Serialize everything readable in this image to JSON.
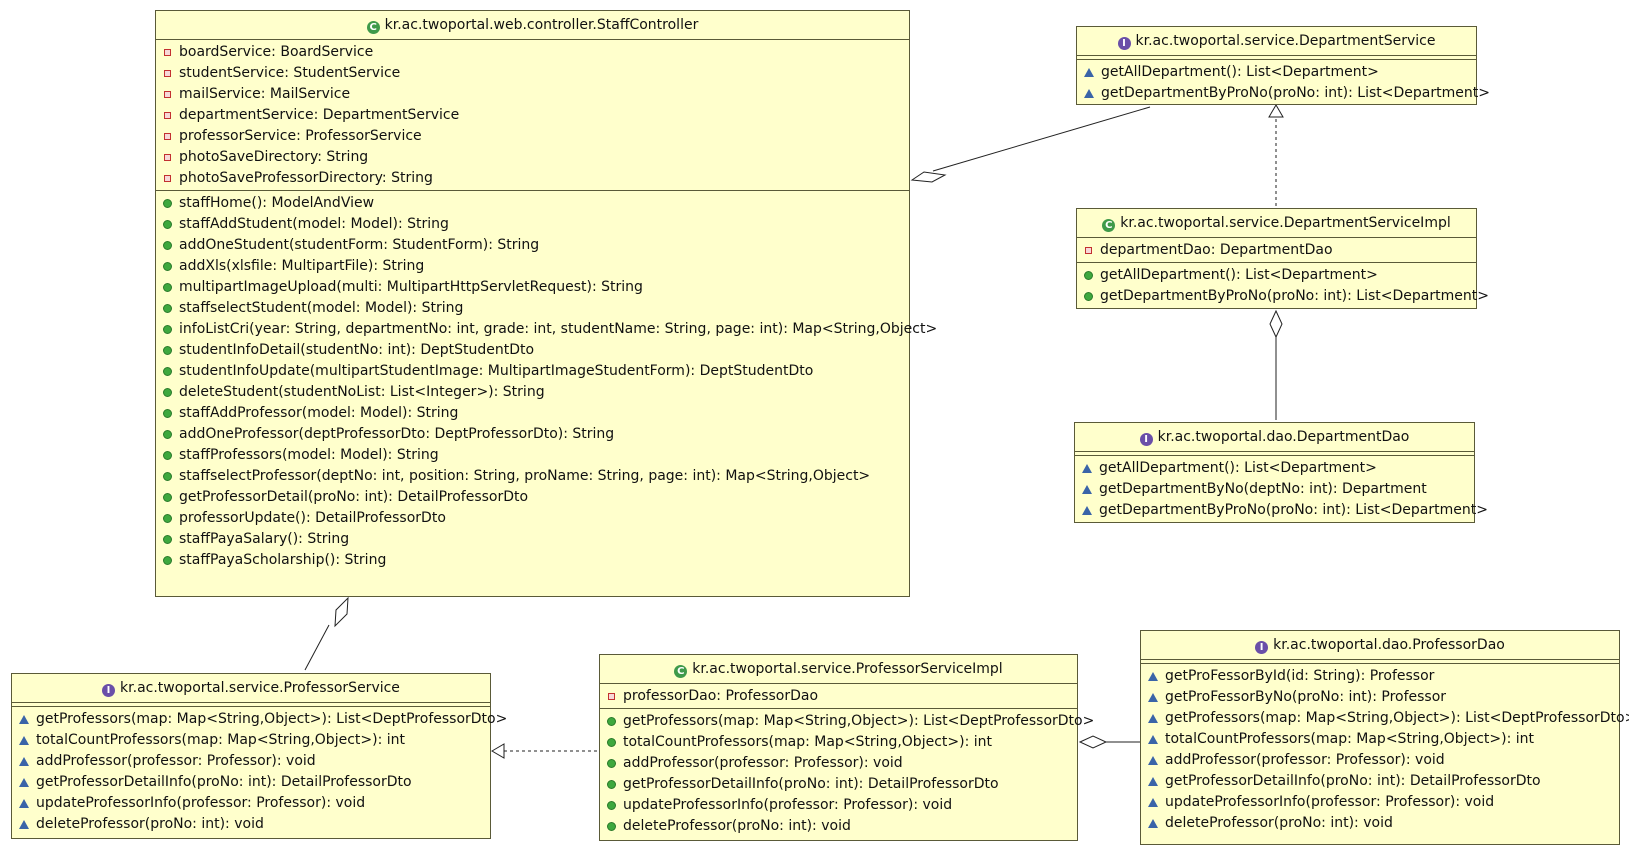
{
  "staffController": {
    "name": "kr.ac.twoportal.web.controller.StaffController",
    "kind": "class",
    "fields": [
      "boardService: BoardService",
      "studentService: StudentService",
      "mailService: MailService",
      "departmentService: DepartmentService",
      "professorService: ProfessorService",
      "photoSaveDirectory: String",
      "photoSaveProfessorDirectory: String"
    ],
    "methods": [
      "staffHome(): ModelAndView",
      "staffAddStudent(model: Model): String",
      "addOneStudent(studentForm: StudentForm): String",
      "addXls(xlsfile: MultipartFile): String",
      "multipartImageUpload(multi: MultipartHttpServletRequest): String",
      "staffselectStudent(model: Model): String",
      "infoListCri(year: String, departmentNo: int, grade: int, studentName: String, page: int): Map<String,Object>",
      "studentInfoDetail(studentNo: int): DeptStudentDto",
      "studentInfoUpdate(multipartStudentImage: MultipartImageStudentForm): DeptStudentDto",
      "deleteStudent(studentNoList: List<Integer>): String",
      "staffAddProfessor(model: Model): String",
      "addOneProfessor(deptProfessorDto: DeptProfessorDto): String",
      "staffProfessors(model: Model): String",
      "staffselectProfessor(deptNo: int, position: String, proName: String, page: int): Map<String,Object>",
      "getProfessorDetail(proNo: int): DetailProfessorDto",
      "professorUpdate(): DetailProfessorDto",
      "staffPayaSalary(): String",
      "staffPayaScholarship(): String"
    ]
  },
  "departmentService": {
    "name": "kr.ac.twoportal.service.DepartmentService",
    "kind": "interface",
    "fields": [],
    "methods": [
      "getAllDepartment(): List<Department>",
      "getDepartmentByProNo(proNo: int): List<Department>"
    ]
  },
  "departmentServiceImpl": {
    "name": "kr.ac.twoportal.service.DepartmentServiceImpl",
    "kind": "class",
    "fields": [
      "departmentDao: DepartmentDao"
    ],
    "methods": [
      "getAllDepartment(): List<Department>",
      "getDepartmentByProNo(proNo: int): List<Department>"
    ]
  },
  "departmentDao": {
    "name": "kr.ac.twoportal.dao.DepartmentDao",
    "kind": "interface",
    "fields": [],
    "methods": [
      "getAllDepartment(): List<Department>",
      "getDepartmentByNo(deptNo: int): Department",
      "getDepartmentByProNo(proNo: int): List<Department>"
    ]
  },
  "professorService": {
    "name": "kr.ac.twoportal.service.ProfessorService",
    "kind": "interface",
    "fields": [],
    "methods": [
      "getProfessors(map: Map<String,Object>): List<DeptProfessorDto>",
      "totalCountProfessors(map: Map<String,Object>): int",
      "addProfessor(professor: Professor): void",
      "getProfessorDetailInfo(proNo: int): DetailProfessorDto",
      "updateProfessorInfo(professor: Professor): void",
      "deleteProfessor(proNo: int): void"
    ]
  },
  "professorServiceImpl": {
    "name": "kr.ac.twoportal.service.ProfessorServiceImpl",
    "kind": "class",
    "fields": [
      "professorDao: ProfessorDao"
    ],
    "methods": [
      "getProfessors(map: Map<String,Object>): List<DeptProfessorDto>",
      "totalCountProfessors(map: Map<String,Object>): int",
      "addProfessor(professor: Professor): void",
      "getProfessorDetailInfo(proNo: int): DetailProfessorDto",
      "updateProfessorInfo(professor: Professor): void",
      "deleteProfessor(proNo: int): void"
    ]
  },
  "professorDao": {
    "name": "kr.ac.twoportal.dao.ProfessorDao",
    "kind": "interface",
    "fields": [],
    "methods": [
      "getProFessorById(id: String): Professor",
      "getProFessorByNo(proNo: int): Professor",
      "getProfessors(map: Map<String,Object>): List<DeptProfessorDto>",
      "totalCountProfessors(map: Map<String,Object>): int",
      "addProfessor(professor: Professor): void",
      "getProfessorDetailInfo(proNo: int): DetailProfessorDto",
      "updateProfessorInfo(professor: Professor): void",
      "deleteProfessor(proNo: int): void"
    ]
  },
  "colors": {
    "box_fill": "#ffffcc",
    "box_border": "#5a5a38",
    "private_marker": "#c23030",
    "public_marker": "#3ea83e",
    "abstract_marker": "#3a64a8",
    "class_icon": "#3f9a4a",
    "interface_icon": "#6a4fa8"
  }
}
